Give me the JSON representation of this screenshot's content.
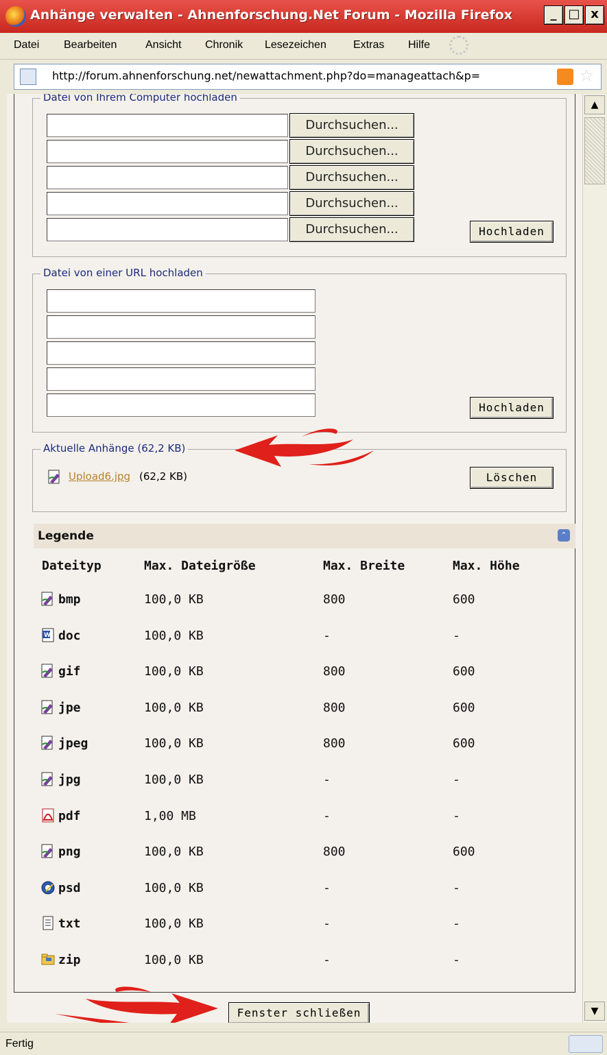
{
  "window": {
    "title": "Anhänge verwalten - Ahnenforschung.Net Forum - Mozilla Firefox",
    "minimize": "_",
    "maximize": "□",
    "close": "x"
  },
  "menu": [
    "Datei",
    "Bearbeiten",
    "Ansicht",
    "Chronik",
    "Lesezeichen",
    "Extras",
    "Hilfe"
  ],
  "address": {
    "url": "http://forum.ahnenforschung.net/newattachment.php?do=manageattach&p="
  },
  "upload_computer": {
    "legend": "Datei von Ihrem Computer hochladen",
    "browse_label": "Durchsuchen...",
    "upload_button": "Hochladen"
  },
  "upload_url": {
    "legend": "Datei von einer URL hochladen",
    "upload_button": "Hochladen"
  },
  "current": {
    "legend": "Aktuelle Anhänge (62,2 KB)",
    "file_name": "Upload6.jpg",
    "file_size": "(62,2 KB)",
    "delete_button": "Löschen"
  },
  "legend_section": {
    "title": "Legende"
  },
  "table": {
    "headers": [
      "Dateityp",
      "Max. Dateigröße",
      "Max. Breite",
      "Max. Höhe"
    ],
    "rows": [
      {
        "ext": "bmp",
        "icon": "image-file-icon",
        "size": "100,0 KB",
        "width": "800",
        "height": "600"
      },
      {
        "ext": "doc",
        "icon": "word-file-icon",
        "size": "100,0 KB",
        "width": "-",
        "height": "-"
      },
      {
        "ext": "gif",
        "icon": "image-file-icon",
        "size": "100,0 KB",
        "width": "800",
        "height": "600"
      },
      {
        "ext": "jpe",
        "icon": "image-file-icon",
        "size": "100,0 KB",
        "width": "800",
        "height": "600"
      },
      {
        "ext": "jpeg",
        "icon": "image-file-icon",
        "size": "100,0 KB",
        "width": "800",
        "height": "600"
      },
      {
        "ext": "jpg",
        "icon": "image-file-icon",
        "size": "100,0 KB",
        "width": "-",
        "height": "-"
      },
      {
        "ext": "pdf",
        "icon": "pdf-file-icon",
        "size": "1,00 MB",
        "width": "-",
        "height": "-"
      },
      {
        "ext": "png",
        "icon": "image-file-icon",
        "size": "100,0 KB",
        "width": "800",
        "height": "600"
      },
      {
        "ext": "psd",
        "icon": "psd-file-icon",
        "size": "100,0 KB",
        "width": "-",
        "height": "-"
      },
      {
        "ext": "txt",
        "icon": "text-file-icon",
        "size": "100,0 KB",
        "width": "-",
        "height": "-"
      },
      {
        "ext": "zip",
        "icon": "zip-file-icon",
        "size": "100,0 KB",
        "width": "-",
        "height": "-"
      }
    ]
  },
  "close_button": "Fenster schließen",
  "status": "Fertig",
  "colors": {
    "title_bar": "#d0342b",
    "link": "#b5822c",
    "legend_text": "#1b2a7a",
    "annotation_arrow": "#e0201a"
  }
}
